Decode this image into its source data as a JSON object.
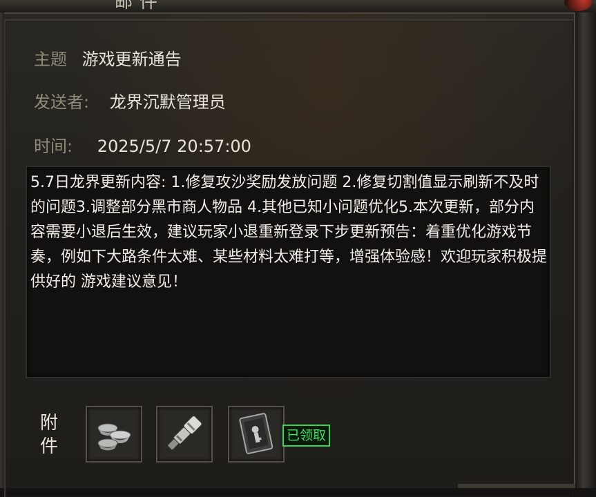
{
  "window": {
    "title": "邮件"
  },
  "header": {
    "subject_label": "主题",
    "subject_value": "游戏更新通告",
    "sender_label": "发送者:",
    "sender_value": "龙界沉默管理员",
    "time_label": "时间:",
    "time_value": "2025/5/7 20:57:00"
  },
  "body": {
    "text": "5.7日龙界更新内容: 1.修复攻沙奖励发放问题 2.修复切割值显示刷新不及时的问题3.调整部分黑市商人物品 4.其他已知小问题优化5.本次更新，部分内容需要小退后生效，建议玩家小退重新登录下步更新预告：着重优化游戏节奏，例如下大路条件太难、某些材料太难打等，增强体验感！欢迎玩家积极提供好的 游戏建议意见！"
  },
  "attachments": {
    "label": "附件",
    "items": [
      {
        "icon": "silver-ingots-icon"
      },
      {
        "icon": "telescope-icon"
      },
      {
        "icon": "scroll-card-icon"
      }
    ],
    "status": "已领取"
  },
  "colors": {
    "label": "#928a78",
    "value": "#e8e4da",
    "claimed": "#39e060"
  }
}
